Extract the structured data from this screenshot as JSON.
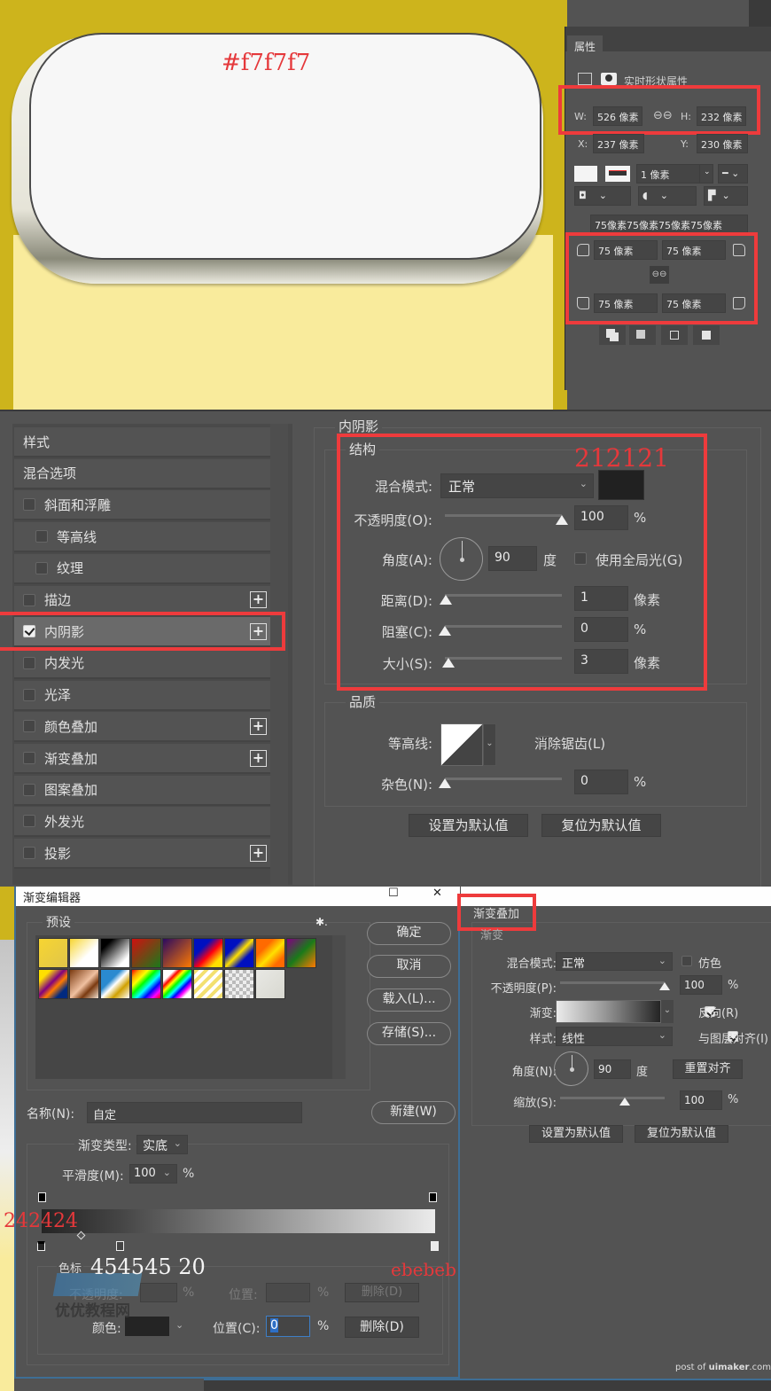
{
  "annotations": {
    "canvas_color": "#f7f7f7",
    "inner_shadow_color": "212121",
    "gradient_left_color": "242424",
    "color_stop_note": "454545  20",
    "gradient_right_color": "ebebeb"
  },
  "colors": {
    "canvas_bg_top": "#cdb41c",
    "canvas_bg_bottom": "#f9eb9c",
    "button_face": "#f7f7f7",
    "annotation_red": "#e5383b",
    "panel_bg": "#535353"
  },
  "properties_panel": {
    "tab": "属性",
    "subtitle": "实时形状属性",
    "w_label": "W:",
    "w_value": "526 像素",
    "h_label": "H:",
    "h_value": "232 像素",
    "x_label": "X:",
    "x_value": "237 像素",
    "y_label": "Y:",
    "y_value": "230 像素",
    "stroke_width": "1 像素",
    "radius_summary": "75像素75像素75像素75像素",
    "radius_tl": "75 像素",
    "radius_tr": "75 像素",
    "radius_bl": "75 像素",
    "radius_br": "75 像素"
  },
  "layer_style": {
    "items": [
      {
        "label": "样式",
        "checkbox": false,
        "plus": false
      },
      {
        "label": "混合选项",
        "checkbox": false,
        "plus": false
      },
      {
        "label": "斜面和浮雕",
        "checkbox": true,
        "checked": false,
        "plus": false
      },
      {
        "label": "等高线",
        "checkbox": true,
        "checked": false,
        "plus": false,
        "indent": true
      },
      {
        "label": "纹理",
        "checkbox": true,
        "checked": false,
        "plus": false,
        "indent": true
      },
      {
        "label": "描边",
        "checkbox": true,
        "checked": false,
        "plus": true
      },
      {
        "label": "内阴影",
        "checkbox": true,
        "checked": true,
        "plus": true,
        "selected": true
      },
      {
        "label": "内发光",
        "checkbox": true,
        "checked": false,
        "plus": false
      },
      {
        "label": "光泽",
        "checkbox": true,
        "checked": false,
        "plus": false
      },
      {
        "label": "颜色叠加",
        "checkbox": true,
        "checked": false,
        "plus": true
      },
      {
        "label": "渐变叠加",
        "checkbox": true,
        "checked": false,
        "plus": true
      },
      {
        "label": "图案叠加",
        "checkbox": true,
        "checked": false,
        "plus": false
      },
      {
        "label": "外发光",
        "checkbox": true,
        "checked": false,
        "plus": false
      },
      {
        "label": "投影",
        "checkbox": true,
        "checked": false,
        "plus": true
      }
    ],
    "inner_shadow": {
      "title": "内阴影",
      "structure_title": "结构",
      "blend_mode_label": "混合模式:",
      "blend_mode_value": "正常",
      "shadow_color": "#212121",
      "opacity_label": "不透明度(O):",
      "opacity_value": "100",
      "opacity_unit": "%",
      "opacity_fraction": 1.0,
      "angle_label": "角度(A):",
      "angle_value": "90",
      "angle_unit": "度",
      "global_light_label": "使用全局光(G)",
      "distance_label": "距离(D):",
      "distance_value": "1",
      "distance_unit": "像素",
      "choke_label": "阻塞(C):",
      "choke_value": "0",
      "choke_unit": "%",
      "size_label": "大小(S):",
      "size_value": "3",
      "size_unit": "像素",
      "quality_title": "品质",
      "contour_label": "等高线:",
      "antialias_label": "消除锯齿(L)",
      "noise_label": "杂色(N):",
      "noise_value": "0",
      "noise_unit": "%",
      "set_default": "设置为默认值",
      "reset_default": "复位为默认值"
    }
  },
  "gradient_editor": {
    "title": "渐变编辑器",
    "presets_label": "预设",
    "ok": "确定",
    "cancel": "取消",
    "load": "载入(L)...",
    "save": "存储(S)...",
    "name_label": "名称(N):",
    "name_value": "自定",
    "new_button": "新建(W)",
    "type_label": "渐变类型:",
    "type_value": "实底",
    "smooth_label": "平滑度(M):",
    "smooth_value": "100",
    "smooth_unit": "%",
    "stops_label": "色标",
    "opacity_label": "不透明度:",
    "opacity_unit": "%",
    "position_label": "位置:",
    "position_unit": "%",
    "delete_label": "删除(D)",
    "color_label": "颜色:",
    "color_position_label": "位置(C):",
    "color_position_value": "0",
    "color_position_unit": "%",
    "delete_color_label": "删除(D)",
    "stop_color": "#242424",
    "color_stops": [
      {
        "color": "#242424",
        "location": 0
      },
      {
        "color": "#454545",
        "location": 20
      },
      {
        "color": "#ebebeb",
        "location": 100
      }
    ]
  },
  "gradient_overlay": {
    "title": "渐变叠加",
    "subtitle": "渐变",
    "blend_mode_label": "混合模式:",
    "blend_mode_value": "正常",
    "dither_label": "仿色",
    "opacity_label": "不透明度(P):",
    "opacity_value": "100",
    "opacity_unit": "%",
    "gradient_label": "渐变:",
    "reverse_label": "反向(R)",
    "style_label": "样式:",
    "style_value": "线性",
    "align_label": "与图层对齐(I)",
    "angle_label": "角度(N):",
    "angle_value": "90",
    "angle_unit": "度",
    "reset_align": "重置对齐",
    "scale_label": "缩放(S):",
    "scale_value": "100",
    "scale_unit": "%",
    "scale_fraction": 0.5,
    "set_default": "设置为默认值",
    "reset_default": "复位为默认值"
  },
  "watermarks": {
    "site_cn": "优优教程网",
    "post_of": "post of ",
    "uimaker": "uimaker",
    "dotcom": ".com"
  }
}
